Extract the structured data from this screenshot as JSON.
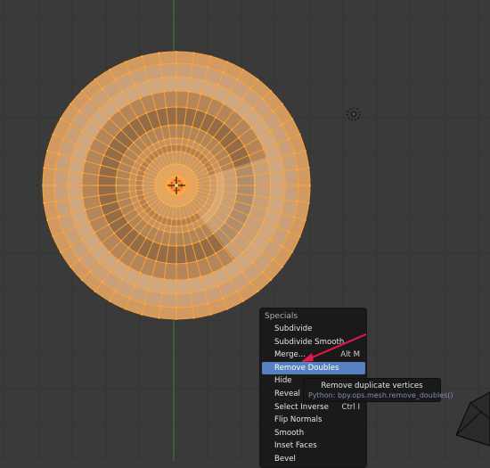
{
  "menu": {
    "title": "Specials",
    "items": [
      {
        "label": "Subdivide",
        "shortcut": ""
      },
      {
        "label": "Subdivide Smooth",
        "shortcut": ""
      },
      {
        "label": "Merge...",
        "shortcut": "Alt M"
      },
      {
        "label": "Remove Doubles",
        "shortcut": ""
      },
      {
        "label": "Hide",
        "shortcut": ""
      },
      {
        "label": "Reveal",
        "shortcut": ""
      },
      {
        "label": "Select Inverse",
        "shortcut": "Ctrl I"
      },
      {
        "label": "Flip Normals",
        "shortcut": ""
      },
      {
        "label": "Smooth",
        "shortcut": ""
      },
      {
        "label": "Inset Faces",
        "shortcut": ""
      },
      {
        "label": "Bevel",
        "shortcut": ""
      }
    ],
    "highlighted": "Remove Doubles"
  },
  "tooltip": {
    "title": "Remove duplicate vertices",
    "python": "Python: bpy.ops.mesh.remove_doubles()"
  },
  "colors": {
    "viewport_bg": "#3a3a3a",
    "grid_line": "#343434",
    "y_axis": "#3f7f3f",
    "mesh_edge": "#ffa133",
    "mesh_fill_light": "#c8a27a",
    "mesh_fill_dark": "#8c6a47",
    "menu_highlight": "#5680c2",
    "annotation_arrow": "#e8174a"
  },
  "icons": {
    "origin": "origin-icon",
    "light": "lamp-icon",
    "camera": "camera-icon"
  }
}
